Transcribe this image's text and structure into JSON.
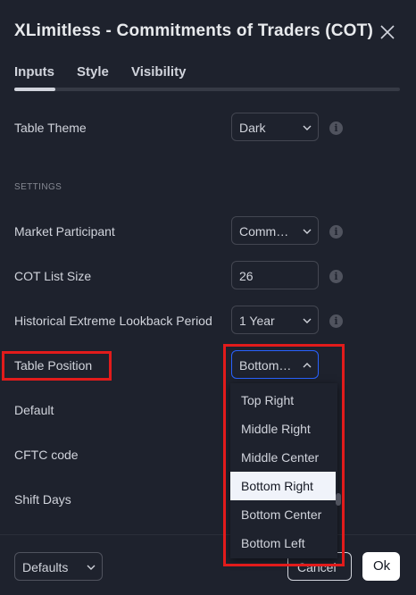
{
  "dialog": {
    "title": "XLimitless - Commitments of Traders (COT)",
    "tabs": [
      {
        "label": "Inputs",
        "active": true
      },
      {
        "label": "Style",
        "active": false
      },
      {
        "label": "Visibility",
        "active": false
      }
    ],
    "table_theme": {
      "label": "Table Theme",
      "value": "Dark"
    },
    "section_settings": "SETTINGS",
    "market_participant": {
      "label": "Market Participant",
      "value": "Commercials"
    },
    "cot_list_size": {
      "label": "COT List Size",
      "value": "26"
    },
    "historical_period": {
      "label": "Historical Extreme Lookback Period",
      "value": "1 Year"
    },
    "table_position": {
      "label": "Table Position",
      "value": "Bottom Right"
    },
    "default_label": "Default",
    "cftc_label": "CFTC code",
    "shift_days_label": "Shift Days",
    "info_glyph": "i",
    "dropdown": {
      "options": [
        "Top Right",
        "Middle Right",
        "Middle Center",
        "Bottom Right",
        "Bottom Center",
        "Bottom Left"
      ],
      "selected": "Bottom Right"
    },
    "footer": {
      "defaults_label": "Defaults",
      "cancel_label": "Cancel",
      "ok_label": "Ok"
    }
  },
  "colors": {
    "background": "#1e222d",
    "accent_focus": "#2962ff",
    "highlight_box": "#e21b1b",
    "selected_item_bg": "#f0f3fa"
  }
}
